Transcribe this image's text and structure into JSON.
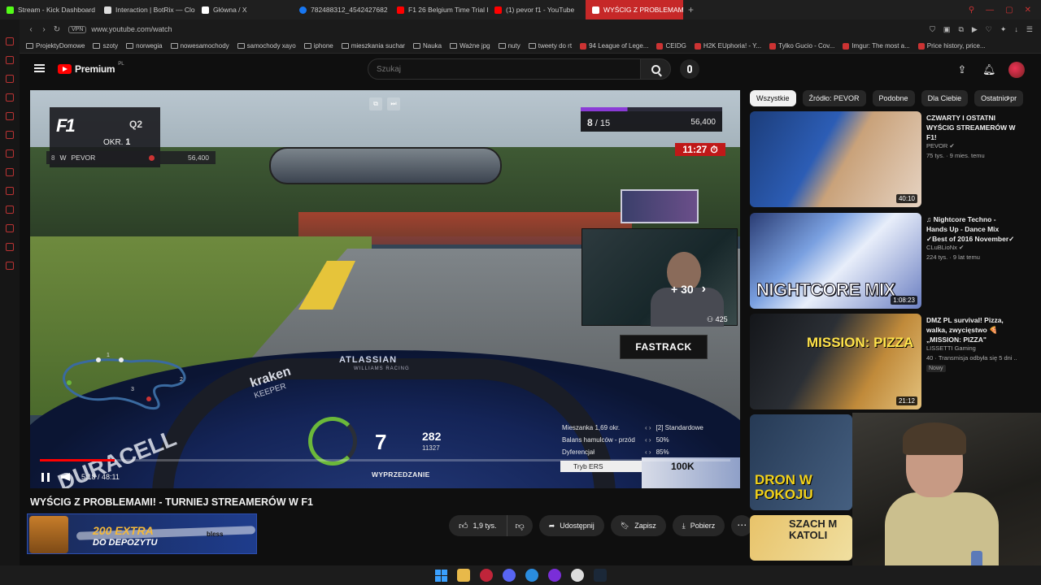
{
  "browser": {
    "tabs": [
      {
        "label": "Stream - Kick Dashboard",
        "color": "#53fc18",
        "active": false
      },
      {
        "label": "Interaction | BotRix — Clou",
        "color": "#dddddd",
        "active": false
      },
      {
        "label": "Główna / X",
        "color": "#ffffff",
        "active": false
      },
      {
        "label": "782488312_4542427682",
        "color": "#1877f2",
        "active": false
      },
      {
        "label": "F1 26 Belgium Time Trial H",
        "color": "#ff0000",
        "active": false
      },
      {
        "label": "(1) pevor f1 - YouTube",
        "color": "#ff0000",
        "active": false
      },
      {
        "label": "WYŚCIG Z PROBLEMAMI",
        "color": "#ffffff",
        "active": true
      }
    ],
    "new_tab": "+",
    "vpn": "VPN",
    "url": "www.youtube.com/watch",
    "bookmarks": [
      {
        "label": "ProjektyDomowe",
        "type": "folder"
      },
      {
        "label": "szoty",
        "type": "folder"
      },
      {
        "label": "norwegia",
        "type": "folder"
      },
      {
        "label": "nowesamochody",
        "type": "folder"
      },
      {
        "label": "samochody xayo",
        "type": "folder"
      },
      {
        "label": "iphone",
        "type": "folder"
      },
      {
        "label": "mieszkania suchar",
        "type": "folder"
      },
      {
        "label": "Nauka",
        "type": "folder"
      },
      {
        "label": "Ważne jpg",
        "type": "folder"
      },
      {
        "label": "nuty",
        "type": "folder"
      },
      {
        "label": "tweety do rt",
        "type": "folder"
      },
      {
        "label": "94 League of Lege...",
        "type": "site"
      },
      {
        "label": "CEIDG",
        "type": "site"
      },
      {
        "label": "H2K EUphoria! - Y...",
        "type": "site"
      },
      {
        "label": "Tylko Gucio - Cov...",
        "type": "site"
      },
      {
        "label": "Imgur: The most a...",
        "type": "site"
      },
      {
        "label": "Price history, price...",
        "type": "site"
      }
    ]
  },
  "youtube": {
    "brand": "Premium",
    "brand_region": "PL",
    "search_placeholder": "Szukaj"
  },
  "player": {
    "overlay": {
      "session": "Q2",
      "lap_label": "OKR.",
      "lap": "1",
      "driver_pos": "8",
      "driver_name": "PEVOR",
      "driver_gap": "56,400",
      "position": "8",
      "total": "/ 15",
      "best_time": "56,400",
      "timer": "11:27",
      "plus": "+ 30",
      "viewers": "425",
      "sponsor": "FASTRACK",
      "halo_brand": "ATLASSIAN",
      "halo_sub": "WILLIAMS RACING",
      "kraken": "kraken",
      "keeper": "KEEPER",
      "duracell": "DURACELL",
      "gear": "7",
      "speed": "282",
      "rpm": "11327",
      "pit": "WYPRZEDZANIE",
      "ers_rows": [
        {
          "label": "Mieszanka 1,69 okr.",
          "value": "[2] Standardowe"
        },
        {
          "label": "Balans hamulców - przód",
          "value": "50%"
        },
        {
          "label": "Dyferencjał",
          "value": "85%"
        }
      ],
      "ers_mode": "Tryb ERS",
      "ad": "100K"
    },
    "progress": 0.108,
    "time_current": "5:18",
    "time_total": "48:11"
  },
  "video": {
    "title": "WYŚCIG Z PROBLEMAMI! - TURNIEJ STREAMERÓW W F1",
    "promo_big": "200 EXTRA",
    "promo_sub": "DO DEPOZYTU",
    "promo_brand": "bless",
    "likes": "1,9 tys.",
    "share": "Udostępnij",
    "save": "Zapisz",
    "download": "Pobierz"
  },
  "chips": [
    "Wszystkie",
    "Źródło: PEVOR",
    "Podobne",
    "Dla Ciebie",
    "Ostatnio pr"
  ],
  "recommendations": [
    {
      "title": "CZWARTY I OSTATNI WYŚCIG STREAMERÓW W F1!",
      "channel": "PEVOR",
      "meta": "75 tys. · 9 mies. temu",
      "duration": "40:10"
    },
    {
      "title": "♫ Nightcore Techno - Hands Up - Dance Mix ✓Best of 2016 November✓ • Part 1 •",
      "channel": "CLuBLioNx",
      "meta": "224 tys. · 9 lat temu",
      "duration": "1:08:23",
      "thumb_text": "NIGHTCORE MIX"
    },
    {
      "title": "DMZ PL survival! Pizza, walka, zwycięstwo 🍕 „MISSION: PIZZA\"",
      "channel": "LISSETTI Gaming",
      "meta": "40 · Transmisja odbyła się 5 dni ...",
      "duration": "21:12",
      "badge": "Nowy",
      "thumb_text": "MISSION: PIZZA"
    },
    {
      "title": "",
      "channel": "",
      "meta": "",
      "duration": "",
      "thumb_text": "DRON W POKOJU"
    },
    {
      "title": "",
      "channel": "",
      "meta": "",
      "duration": "",
      "thumb_text": "SZACH M KATOLI"
    }
  ]
}
